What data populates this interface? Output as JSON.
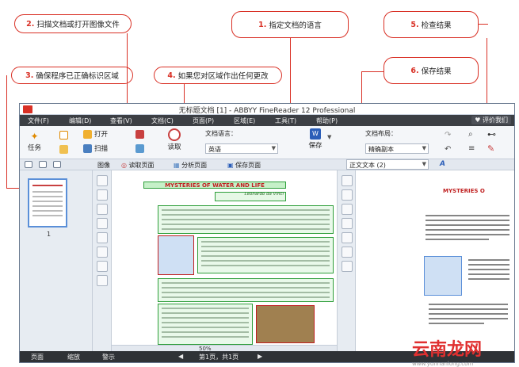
{
  "callouts": [
    {
      "num": "2.",
      "text": "扫描文档或打开图像文件"
    },
    {
      "num": "1.",
      "text": "指定文档的语言"
    },
    {
      "num": "5.",
      "text": "检查结果"
    },
    {
      "num": "3.",
      "text": "确保程序已正确标识区域"
    },
    {
      "num": "4.",
      "text": "如果您对区域作出任何更改"
    },
    {
      "num": "6.",
      "text": "保存结果"
    }
  ],
  "window": {
    "title": "无标题文档 [1] - ABBYY FineReader 12 Professional"
  },
  "menu": {
    "items": [
      "文件(F)",
      "编辑(D)",
      "查看(V)",
      "文档(C)",
      "页面(P)",
      "区域(E)",
      "工具(T)",
      "帮助(P)"
    ],
    "rate": "评价我们"
  },
  "ribbon": {
    "task": "任务",
    "open": "打开",
    "scan": "扫描",
    "read": "读取",
    "lang_label": "文档语言：",
    "lang_value": "英语",
    "save": "保存",
    "layout_label": "文档布局：",
    "layout_value": "精确副本"
  },
  "toolbar": {
    "image": "图像",
    "read_page": "读取页面",
    "analyze_page": "分析页面",
    "save_page": "保存页面",
    "text_view": "正文文本 (2)"
  },
  "pages": {
    "thumb_number": "1"
  },
  "document": {
    "title": "MYSTERIES OF WATER AND LIFE",
    "subtitle": "Leonardo da Vinci",
    "text_title": "MYSTERIES O"
  },
  "image_status": {
    "zoom": "50%"
  },
  "statusbar": {
    "pages": "页面",
    "zoom": "缩放",
    "warnings": "警示",
    "page_info": "第1页，共1页"
  },
  "watermark": {
    "text": "云南龙网",
    "sub": "www.yunnanlong.com"
  }
}
